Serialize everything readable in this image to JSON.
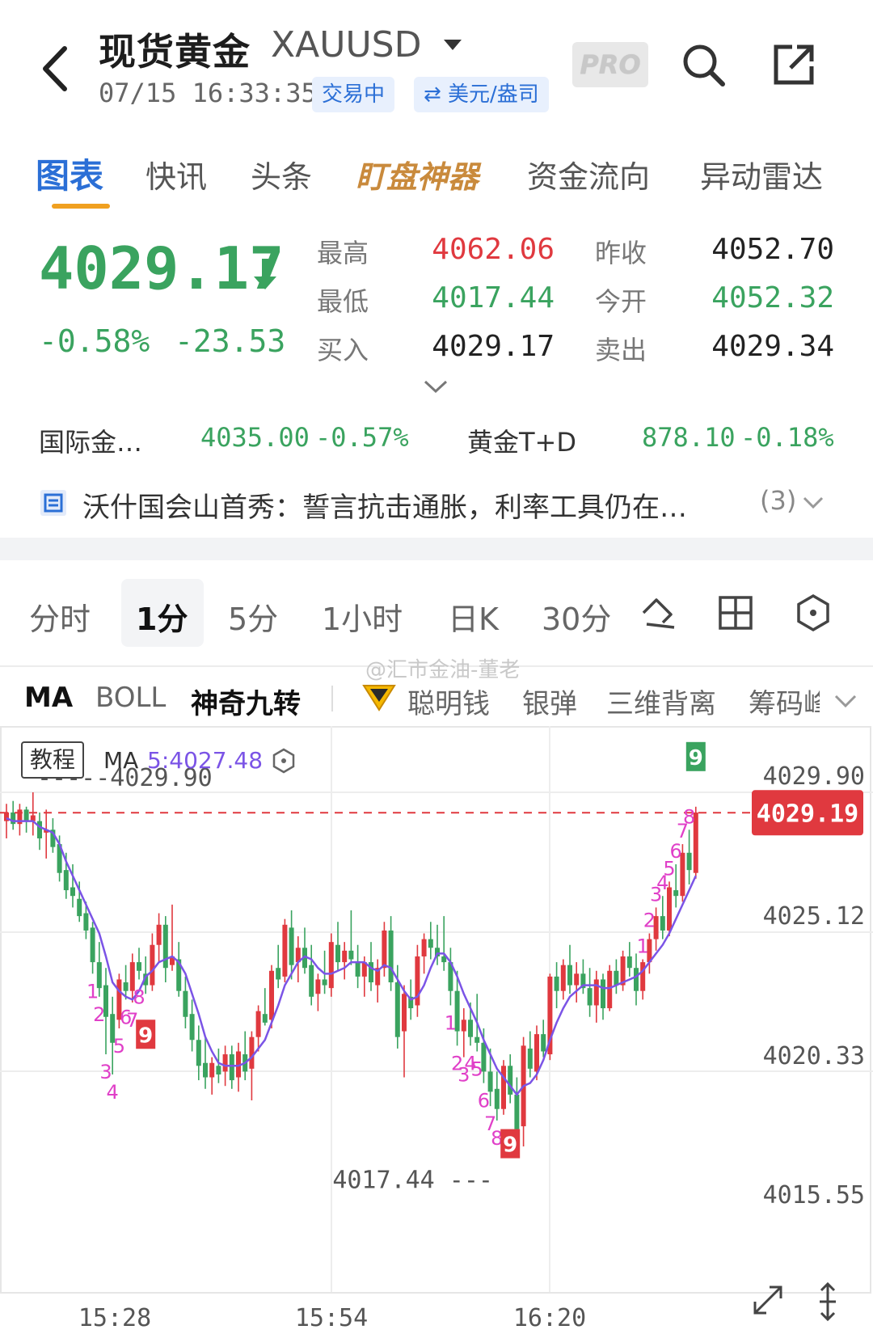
{
  "header": {
    "title": "现货黄金",
    "symbol": "XAUUSD",
    "timestamp": "07/15 16:33:35",
    "status_badge": "交易中",
    "currency_badge": "⇄ 美元/盎司",
    "pro_label": "PRO"
  },
  "tabs": [
    {
      "label": "图表",
      "active": true
    },
    {
      "label": "快讯"
    },
    {
      "label": "头条"
    },
    {
      "label": "盯盘神器"
    },
    {
      "label": "资金流向"
    },
    {
      "label": "异动雷达"
    }
  ],
  "quote": {
    "price": "4029.17",
    "change_pct": "-0.58%",
    "change_abs": "-23.53",
    "high_label": "最高",
    "high": "4062.06",
    "low_label": "最低",
    "low": "4017.44",
    "bid_label": "买入",
    "bid": "4029.17",
    "prev_close_label": "昨收",
    "prev_close": "4052.70",
    "open_label": "今开",
    "open": "4052.32",
    "ask_label": "卖出",
    "ask": "4029.34"
  },
  "related": [
    {
      "name": "国际金…",
      "value": "4035.00",
      "change": "-0.57%"
    },
    {
      "name": "黄金T+D",
      "value": "878.10",
      "change": "-0.18%"
    }
  ],
  "news": {
    "text": "沃什国会山首秀：誓言抗击通胀，利率工具仍在…",
    "count": "(3)"
  },
  "periods": [
    {
      "label": "分时"
    },
    {
      "label": "1分",
      "active": true
    },
    {
      "label": "5分"
    },
    {
      "label": "1小时"
    },
    {
      "label": "日K"
    },
    {
      "label": "30分"
    }
  ],
  "indicators": [
    {
      "label": "MA",
      "active": true
    },
    {
      "label": "BOLL"
    },
    {
      "label": "神奇九转",
      "active": true
    },
    {
      "label": "聪明钱"
    },
    {
      "label": "银弹"
    },
    {
      "label": "三维背离"
    },
    {
      "label": "筹码峰"
    }
  ],
  "watermark_top": "@汇市金油-董老",
  "chart_header": {
    "tutorial": "教程",
    "ma_label": "MA",
    "ma_value": "5:4027.48"
  },
  "chart_data": {
    "type": "candlestick",
    "y_ticks": [
      "4029.90",
      "4025.12",
      "4020.33",
      "4015.55"
    ],
    "x_ticks": [
      "15:28",
      "15:54",
      "16:20"
    ],
    "current_price_label": "4029.19",
    "max_marker": "4029.90",
    "min_marker": "4017.44",
    "ylim": [
      4015.55,
      4029.9
    ],
    "colors": {
      "up": "#e0393f",
      "down": "#3aa35f",
      "ma": "#7b54e6",
      "td": "#e040c8"
    },
    "candles": [
      [
        4028.9,
        4029.5,
        4028.3,
        4029.2
      ],
      [
        4029.2,
        4029.6,
        4028.6,
        4028.8
      ],
      [
        4028.8,
        4029.5,
        4028.4,
        4029.3
      ],
      [
        4029.3,
        4029.4,
        4028.5,
        4028.9
      ],
      [
        4028.9,
        4029.9,
        4028.4,
        4029.1
      ],
      [
        4028.9,
        4029.2,
        4027.9,
        4028.3
      ],
      [
        4028.5,
        4029.3,
        4027.6,
        4028.6
      ],
      [
        4028.6,
        4029.0,
        4027.8,
        4028.0
      ],
      [
        4028.1,
        4028.4,
        4026.8,
        4027.1
      ],
      [
        4027.2,
        4027.8,
        4026.2,
        4026.5
      ],
      [
        4026.6,
        4027.4,
        4025.9,
        4026.3
      ],
      [
        4026.2,
        4026.8,
        4025.4,
        4025.6
      ],
      [
        4025.7,
        4026.1,
        4024.8,
        4025.1
      ],
      [
        4025.2,
        4025.4,
        4023.6,
        4024.0
      ],
      [
        4024.0,
        4024.7,
        4022.8,
        4023.1
      ],
      [
        4023.2,
        4023.8,
        4020.8,
        4022.1
      ],
      [
        4022.2,
        4022.8,
        4020.1,
        4021.2
      ],
      [
        4022.0,
        4023.6,
        4021.7,
        4023.4
      ],
      [
        4023.3,
        4023.9,
        4022.7,
        4023.0
      ],
      [
        4023.0,
        4024.3,
        4022.6,
        4024.0
      ],
      [
        4024.0,
        4024.5,
        4023.4,
        4023.7
      ],
      [
        4023.6,
        4024.2,
        4022.9,
        4023.2
      ],
      [
        4023.2,
        4025.0,
        4023.0,
        4024.6
      ],
      [
        4024.6,
        4025.7,
        4024.0,
        4025.3
      ],
      [
        4025.3,
        4025.6,
        4023.3,
        4023.8
      ],
      [
        4023.9,
        4026.0,
        4023.7,
        4024.2
      ],
      [
        4024.1,
        4024.7,
        4022.8,
        4023.0
      ],
      [
        4023.0,
        4023.5,
        4021.7,
        4022.1
      ],
      [
        4022.2,
        4022.7,
        4020.9,
        4021.3
      ],
      [
        4021.3,
        4021.8,
        4019.9,
        4020.4
      ],
      [
        4020.5,
        4021.4,
        4019.6,
        4020.0
      ],
      [
        4020.0,
        4020.7,
        4019.4,
        4020.5
      ],
      [
        4020.4,
        4021.0,
        4019.8,
        4020.1
      ],
      [
        4020.2,
        4021.1,
        4019.7,
        4020.8
      ],
      [
        4020.8,
        4021.1,
        4019.6,
        4019.9
      ],
      [
        4020.0,
        4021.2,
        4019.5,
        4020.9
      ],
      [
        4020.8,
        4021.6,
        4019.9,
        4020.2
      ],
      [
        4020.3,
        4021.6,
        4019.2,
        4021.4
      ],
      [
        4021.4,
        4022.5,
        4020.9,
        4022.3
      ],
      [
        4022.2,
        4023.1,
        4021.8,
        4021.9
      ],
      [
        4022.0,
        4023.9,
        4021.7,
        4023.7
      ],
      [
        4023.8,
        4024.6,
        4023.1,
        4023.4
      ],
      [
        4023.5,
        4025.5,
        4023.3,
        4025.3
      ],
      [
        4025.2,
        4025.8,
        4023.4,
        4023.9
      ],
      [
        4024.0,
        4024.9,
        4023.3,
        4024.5
      ],
      [
        4024.5,
        4025.2,
        4023.6,
        4023.8
      ],
      [
        4023.9,
        4024.6,
        4022.5,
        4022.8
      ],
      [
        4022.9,
        4023.6,
        4022.3,
        4023.4
      ],
      [
        4023.4,
        4024.4,
        4022.9,
        4023.2
      ],
      [
        4023.1,
        4025.0,
        4022.8,
        4024.7
      ],
      [
        4024.6,
        4025.4,
        4023.7,
        4024.0
      ],
      [
        4024.0,
        4024.7,
        4023.4,
        4024.4
      ],
      [
        4024.4,
        4025.8,
        4023.9,
        4024.1
      ],
      [
        4024.0,
        4024.6,
        4023.1,
        4023.5
      ],
      [
        4023.5,
        4024.2,
        4022.8,
        4024.0
      ],
      [
        4024.0,
        4024.7,
        4023.0,
        4023.3
      ],
      [
        4023.2,
        4024.1,
        4022.6,
        4023.8
      ],
      [
        4023.8,
        4025.4,
        4023.5,
        4025.1
      ],
      [
        4025.1,
        4025.6,
        4023.0,
        4023.3
      ],
      [
        4023.3,
        4023.9,
        4021.0,
        4021.4
      ],
      [
        4021.6,
        4023.2,
        4020.0,
        4022.9
      ],
      [
        4022.8,
        4023.4,
        4022.0,
        4022.4
      ],
      [
        4022.5,
        4024.6,
        4022.1,
        4024.2
      ],
      [
        4024.2,
        4025.0,
        4023.6,
        4024.8
      ],
      [
        4024.8,
        4025.4,
        4024.1,
        4024.5
      ],
      [
        4024.5,
        4025.3,
        4023.9,
        4024.2
      ],
      [
        4024.2,
        4025.6,
        4023.7,
        4024.0
      ],
      [
        4024.0,
        4024.5,
        4022.5,
        4023.0
      ],
      [
        4023.0,
        4023.7,
        4021.1,
        4021.6
      ],
      [
        4021.6,
        4022.4,
        4020.7,
        4022.0
      ],
      [
        4022.0,
        4022.6,
        4021.1,
        4021.4
      ],
      [
        4021.4,
        4022.9,
        4020.9,
        4021.2
      ],
      [
        4021.2,
        4021.7,
        4019.8,
        4020.2
      ],
      [
        4020.2,
        4021.0,
        4019.0,
        4019.5
      ],
      [
        4019.6,
        4020.2,
        4018.5,
        4018.9
      ],
      [
        4018.9,
        4020.6,
        4018.7,
        4020.4
      ],
      [
        4020.4,
        4020.8,
        4019.1,
        4019.4
      ],
      [
        4019.4,
        4020.0,
        4017.7,
        4018.2
      ],
      [
        4018.3,
        4021.4,
        4017.6,
        4021.1
      ],
      [
        4021.0,
        4021.6,
        4020.0,
        4020.3
      ],
      [
        4020.2,
        4021.8,
        4019.9,
        4021.5
      ],
      [
        4021.5,
        4022.0,
        4020.7,
        4020.9
      ],
      [
        4020.8,
        4023.6,
        4020.6,
        4023.5
      ],
      [
        4023.5,
        4024.0,
        4022.4,
        4023.0
      ],
      [
        4023.0,
        4024.1,
        4022.7,
        4023.9
      ],
      [
        4023.9,
        4024.6,
        4022.9,
        4023.2
      ],
      [
        4023.2,
        4024.0,
        4022.6,
        4023.6
      ],
      [
        4023.6,
        4024.1,
        4022.9,
        4023.1
      ],
      [
        4023.1,
        4023.8,
        4022.1,
        4022.5
      ],
      [
        4022.5,
        4023.7,
        4021.9,
        4023.4
      ],
      [
        4023.4,
        4023.6,
        4022.0,
        4022.4
      ],
      [
        4022.4,
        4023.9,
        4022.3,
        4023.7
      ],
      [
        4023.7,
        4024.1,
        4022.9,
        4023.2
      ],
      [
        4023.2,
        4024.4,
        4023.0,
        4024.2
      ],
      [
        4024.2,
        4024.7,
        4023.5,
        4023.8
      ],
      [
        4023.8,
        4024.3,
        4022.5,
        4023.0
      ],
      [
        4023.0,
        4024.1,
        4022.7,
        4024.0
      ],
      [
        4024.0,
        4025.0,
        4023.6,
        4024.8
      ],
      [
        4024.8,
        4025.9,
        4024.4,
        4025.6
      ],
      [
        4025.6,
        4026.3,
        4024.8,
        4025.1
      ],
      [
        4025.1,
        4026.8,
        4024.9,
        4026.6
      ],
      [
        4026.5,
        4027.4,
        4025.9,
        4026.3
      ],
      [
        4026.3,
        4028.1,
        4026.1,
        4027.8
      ],
      [
        4027.8,
        4028.6,
        4026.7,
        4027.2
      ],
      [
        4027.1,
        4029.4,
        4026.9,
        4029.2
      ]
    ],
    "ma5": [
      4029.0,
      4028.9,
      4028.9,
      4028.9,
      4028.9,
      4028.7,
      4028.6,
      4028.5,
      4028.1,
      4027.5,
      4027.0,
      4026.5,
      4026.0,
      4025.5,
      4025.0,
      4024.2,
      4023.3,
      4023.0,
      4022.8,
      4022.7,
      4023.0,
      4023.5,
      4023.7,
      4024.0,
      4024.1,
      4024.2,
      4024.0,
      4023.6,
      4022.9,
      4022.2,
      4021.4,
      4020.9,
      4020.5,
      4020.4,
      4020.4,
      4020.4,
      4020.5,
      4020.7,
      4021.0,
      4021.3,
      4021.9,
      4022.5,
      4023.2,
      4023.6,
      4024.0,
      4024.2,
      4024.1,
      4023.8,
      4023.6,
      4023.6,
      4023.7,
      4023.8,
      4024.0,
      4024.0,
      4024.0,
      4023.8,
      4023.7,
      4023.9,
      4023.8,
      4023.4,
      4023.0,
      4022.7,
      4022.8,
      4023.2,
      4023.8,
      4024.3,
      4024.3,
      4024.0,
      4023.5,
      4022.9,
      4022.4,
      4021.9,
      4021.3,
      4020.8,
      4020.3,
      4020.0,
      4019.7,
      4019.4,
      4019.7,
      4019.8,
      4020.1,
      4020.6,
      4021.3,
      4021.9,
      4022.4,
      4022.8,
      4023.0,
      4023.2,
      4023.2,
      4023.2,
      4023.1,
      4023.1,
      4023.2,
      4023.3,
      4023.4,
      4023.5,
      4023.7,
      4024.0,
      4024.3,
      4024.6,
      4025.0,
      4025.5,
      4026.0,
      4026.5,
      4027.0
    ],
    "td_markers": [
      {
        "i": 13,
        "label": "1",
        "pos": "below"
      },
      {
        "i": 14,
        "label": "2",
        "pos": "below"
      },
      {
        "i": 15,
        "label": "3",
        "pos": "below"
      },
      {
        "i": 16,
        "label": "4",
        "pos": "below"
      },
      {
        "i": 17,
        "label": "5",
        "pos": "below"
      },
      {
        "i": 18,
        "label": "6",
        "pos": "below"
      },
      {
        "i": 19,
        "label": "7",
        "pos": "below"
      },
      {
        "i": 20,
        "label": "8",
        "pos": "below"
      },
      {
        "i": 21,
        "label": "9",
        "pos": "boxed-below"
      },
      {
        "i": 67,
        "label": "1",
        "pos": "below"
      },
      {
        "i": 68,
        "label": "2",
        "pos": "below"
      },
      {
        "i": 69,
        "label": "3",
        "pos": "below"
      },
      {
        "i": 70,
        "label": "4",
        "pos": "below"
      },
      {
        "i": 71,
        "label": "5",
        "pos": "below"
      },
      {
        "i": 72,
        "label": "6",
        "pos": "below"
      },
      {
        "i": 73,
        "label": "7",
        "pos": "below"
      },
      {
        "i": 74,
        "label": "8",
        "pos": "below"
      },
      {
        "i": 76,
        "label": "9",
        "pos": "boxed-below"
      },
      {
        "i": 96,
        "label": "1",
        "pos": "above"
      },
      {
        "i": 97,
        "label": "2",
        "pos": "above"
      },
      {
        "i": 98,
        "label": "3",
        "pos": "above"
      },
      {
        "i": 99,
        "label": "4",
        "pos": "above"
      },
      {
        "i": 100,
        "label": "5",
        "pos": "above"
      },
      {
        "i": 101,
        "label": "6",
        "pos": "above"
      },
      {
        "i": 102,
        "label": "7",
        "pos": "above"
      },
      {
        "i": 103,
        "label": "8",
        "pos": "above"
      },
      {
        "i": 104,
        "label": "9",
        "pos": "boxed-above"
      }
    ]
  }
}
